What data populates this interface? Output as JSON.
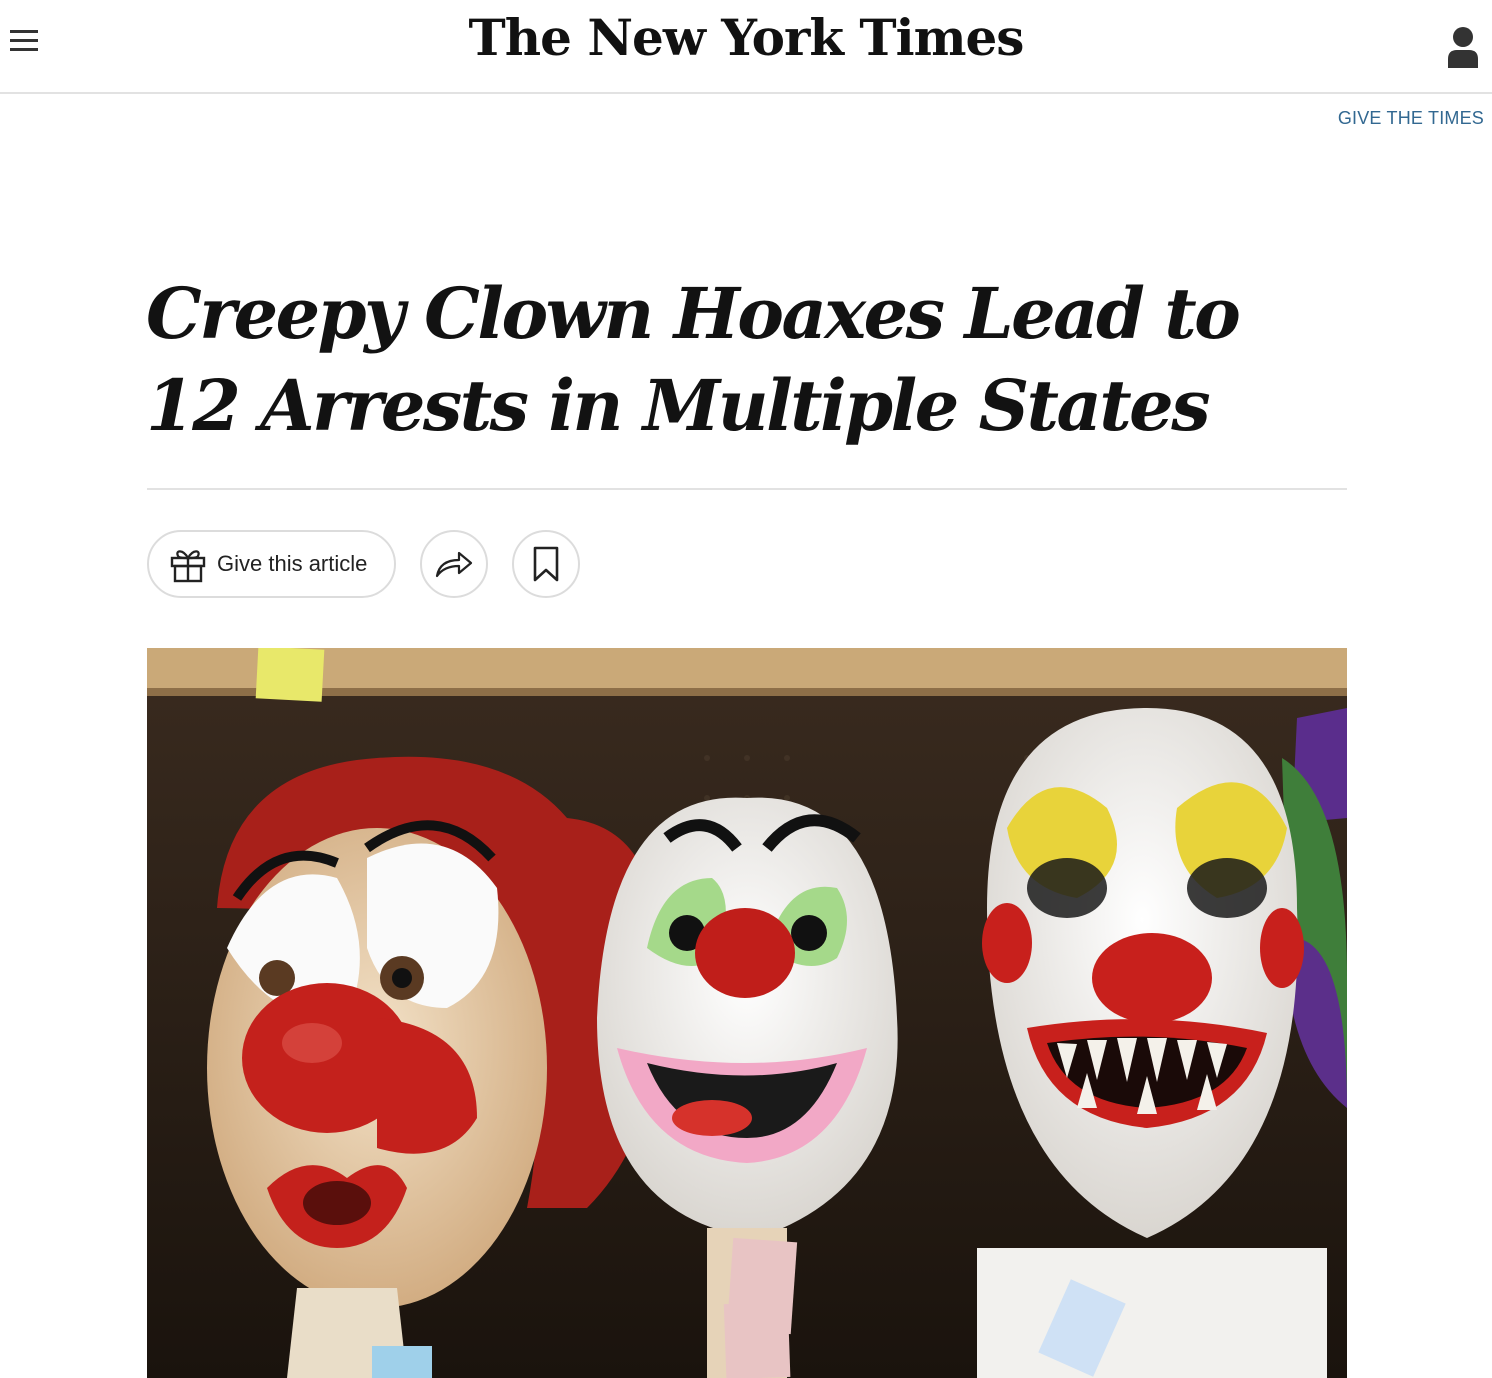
{
  "header": {
    "menu_icon": "hamburger-menu-icon",
    "logo_text": "The New York Times",
    "account_icon": "user-account-icon"
  },
  "promo": {
    "give_the_times": "GIVE THE TIMES"
  },
  "article": {
    "headline": "Creepy Clown Hoaxes Lead to 12 Arrests in Multiple States"
  },
  "actions": {
    "give_label": "Give this article",
    "gift_icon": "gift-icon",
    "share_icon": "share-arrow-icon",
    "save_icon": "bookmark-icon"
  },
  "image": {
    "subject": "three clown masks on display shelf",
    "colors": {
      "shelf": "#caa978",
      "background": "#2a1e16",
      "accent_red": "#c8201c"
    }
  }
}
